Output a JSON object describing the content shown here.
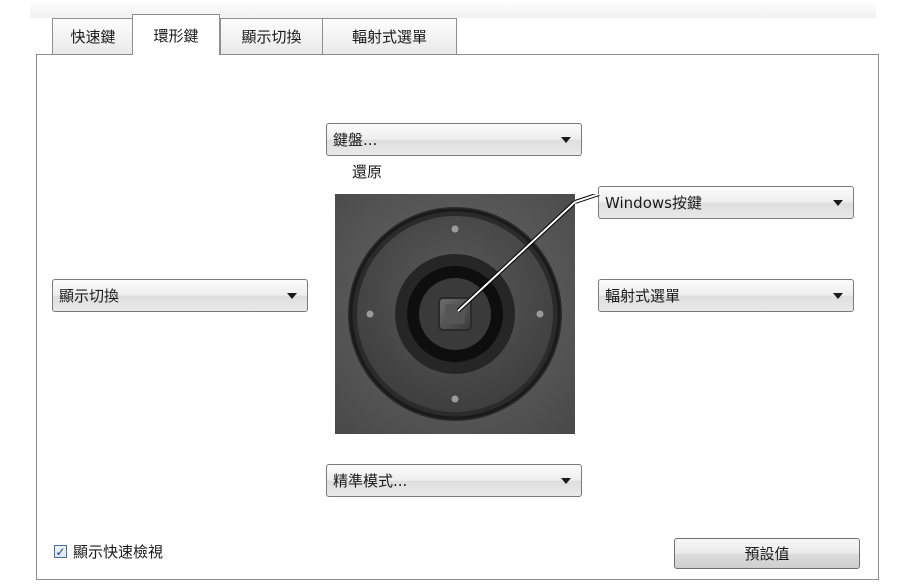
{
  "tabs": [
    {
      "label": "快速鍵",
      "active": false
    },
    {
      "label": "環形鍵",
      "active": true
    },
    {
      "label": "顯示切換",
      "active": false
    },
    {
      "label": "輻射式選單",
      "active": false
    }
  ],
  "ring": {
    "top": {
      "selected": "鍵盤...",
      "caption": "還原"
    },
    "left": {
      "selected": "顯示切換"
    },
    "right_upper": {
      "selected": "Windows按鍵"
    },
    "right_lower": {
      "selected": "輻射式選單"
    },
    "bottom": {
      "selected": "精準模式..."
    }
  },
  "show_quick_view": {
    "label": "顯示快速檢視",
    "checked": true
  },
  "defaults_button": {
    "label": "預設值"
  },
  "icons": [
    "chevron-down-icon",
    "checkbox-check-icon",
    "touch-ring-image"
  ]
}
